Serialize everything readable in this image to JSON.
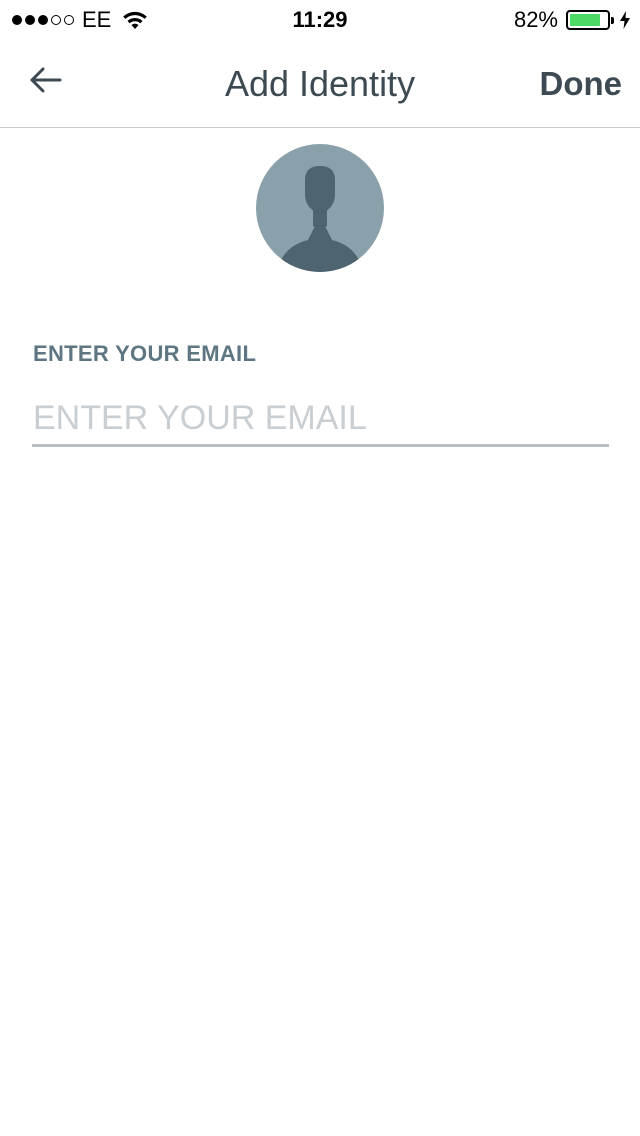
{
  "status_bar": {
    "carrier": "EE",
    "time": "11:29",
    "battery_percent_text": "82%",
    "battery_level": 0.82,
    "signal_bars_filled": 3,
    "signal_bars_total": 5
  },
  "nav": {
    "title": "Add Identity",
    "done_label": "Done",
    "back_icon": "arrow-left-icon"
  },
  "avatar": {
    "icon": "person-silhouette-icon",
    "background_color": "#8aa1ac",
    "figure_color": "#4e6470"
  },
  "email": {
    "label": "ENTER YOUR EMAIL",
    "placeholder": "ENTER YOUR EMAIL",
    "value": ""
  },
  "colors": {
    "text_primary": "#3d4a52",
    "label": "#5e7682",
    "battery_green": "#4cd964",
    "underline": "#b6c0c6"
  }
}
